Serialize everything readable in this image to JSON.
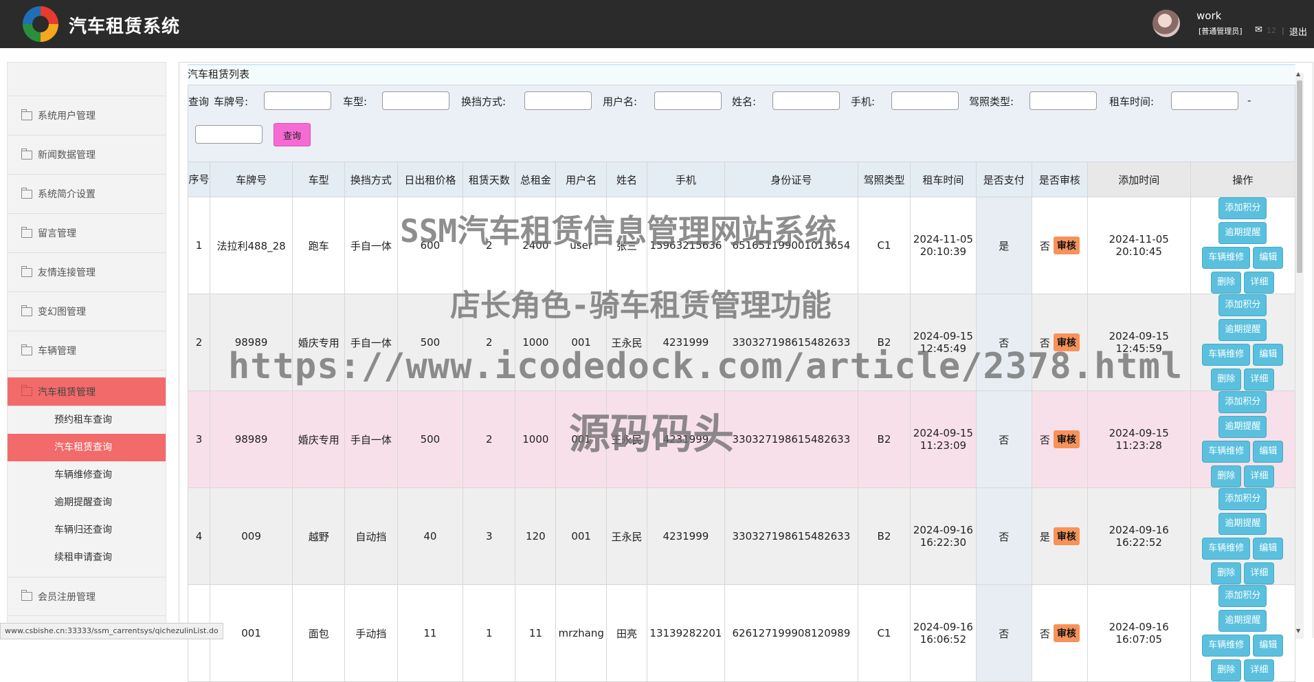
{
  "header": {
    "app_title": "汽车租赁系统",
    "user_name": "work",
    "user_role": "[普通管理员]",
    "mail_count": "12",
    "divider": "|",
    "logout_label": "退出"
  },
  "sidebar": {
    "items": [
      {
        "label": "系统用户管理"
      },
      {
        "label": "新闻数据管理"
      },
      {
        "label": "系统简介设置"
      },
      {
        "label": "留言管理"
      },
      {
        "label": "友情连接管理"
      },
      {
        "label": "变幻图管理"
      },
      {
        "label": "车辆管理"
      }
    ],
    "active_group": "汽车租赁管理",
    "sub_items": [
      {
        "label": "预约租车查询"
      },
      {
        "label": "汽车租赁查询"
      },
      {
        "label": "车辆维修查询"
      },
      {
        "label": "逾期提醒查询"
      },
      {
        "label": "车辆归还查询"
      },
      {
        "label": "续租申请查询"
      }
    ],
    "bottom_item": "会员注册管理"
  },
  "panel": {
    "title": "汽车租赁列表"
  },
  "search": {
    "prefix": "查询",
    "plate_label": "车牌号:",
    "model_label": "车型:",
    "gear_label": "换挡方式:",
    "username_label": "用户名:",
    "name_label": "姓名:",
    "phone_label": "手机:",
    "license_label": "驾照类型:",
    "rent_time_label": "租车时间:",
    "range_sep": "-",
    "query_button": "查询"
  },
  "table": {
    "headers": {
      "seq": "序号",
      "plate": "车牌号",
      "model": "车型",
      "gear": "换挡方式",
      "price": "日出租价格",
      "days": "租赁天数",
      "total": "总租金",
      "username": "用户名",
      "name": "姓名",
      "phone": "手机",
      "idcard": "身份证号",
      "license": "驾照类型",
      "rent_time": "租车时间",
      "paid": "是否支付",
      "audited": "是否审核",
      "added": "添加时间",
      "ops": "操作"
    },
    "rows": [
      {
        "seq": "1",
        "plate": "法拉利488_28",
        "model": "跑车",
        "gear": "手自一体",
        "price": "600",
        "days": "2",
        "total": "2400",
        "username": "user",
        "name": "张三",
        "phone": "15963215636",
        "idcard": "651651199001013654",
        "license": "C1",
        "rent_date": "2024-11-05",
        "rent_clock": "20:10:39",
        "paid": "是",
        "audited": "否",
        "added": "2024-11-05 20:10:45"
      },
      {
        "seq": "2",
        "plate": "98989",
        "model": "婚庆专用",
        "gear": "手自一体",
        "price": "500",
        "days": "2",
        "total": "1000",
        "username": "001",
        "name": "王永民",
        "phone": "4231999",
        "idcard": "330327198615482633",
        "license": "B2",
        "rent_date": "2024-09-15",
        "rent_clock": "12:45:49",
        "paid": "否",
        "audited": "否",
        "added": "2024-09-15 12:45:59"
      },
      {
        "seq": "3",
        "plate": "98989",
        "model": "婚庆专用",
        "gear": "手自一体",
        "price": "500",
        "days": "2",
        "total": "1000",
        "username": "001",
        "name": "王永民",
        "phone": "4231999",
        "idcard": "330327198615482633",
        "license": "B2",
        "rent_date": "2024-09-15",
        "rent_clock": "11:23:09",
        "paid": "否",
        "audited": "否",
        "added": "2024-09-15 11:23:28"
      },
      {
        "seq": "4",
        "plate": "009",
        "model": "越野",
        "gear": "自动挡",
        "price": "40",
        "days": "3",
        "total": "120",
        "username": "001",
        "name": "王永民",
        "phone": "4231999",
        "idcard": "330327198615482633",
        "license": "B2",
        "rent_date": "2024-09-16",
        "rent_clock": "16:22:30",
        "paid": "否",
        "audited": "是",
        "added": "2024-09-16 16:22:52"
      },
      {
        "seq": "5",
        "plate": "001",
        "model": "面包",
        "gear": "手动挡",
        "price": "11",
        "days": "1",
        "total": "11",
        "username": "mrzhang",
        "name": "田亮",
        "phone": "13139282201",
        "idcard": "626127199908120989",
        "license": "C1",
        "rent_date": "2024-09-16",
        "rent_clock": "16:06:52",
        "paid": "否",
        "audited": "否",
        "added": "2024-09-16 16:07:05"
      }
    ],
    "buttons": {
      "audit": "审核",
      "add_points": "添加积分",
      "overdue": "逾期提醒",
      "repair": "车辆维修",
      "edit": "编辑",
      "delete": "删除",
      "detail": "详细"
    }
  },
  "watermarks": {
    "line1": "SSM汽车租赁信息管理网站系统",
    "line2": "店长角色-骑车租赁管理功能",
    "line3": "https://www.icodedock.com/article/2378.html",
    "line4": "源码码头"
  },
  "statusbar": {
    "url": "www.csbishe.cn:33333/ssm_carrentsys/qichezulinList.do"
  },
  "colors": {
    "topbar": "#2b2b2b",
    "active_menu": "#f26a6a",
    "query_button": "#f66ad4",
    "audit_button": "#f7925a",
    "op_button": "#5ac0de"
  }
}
